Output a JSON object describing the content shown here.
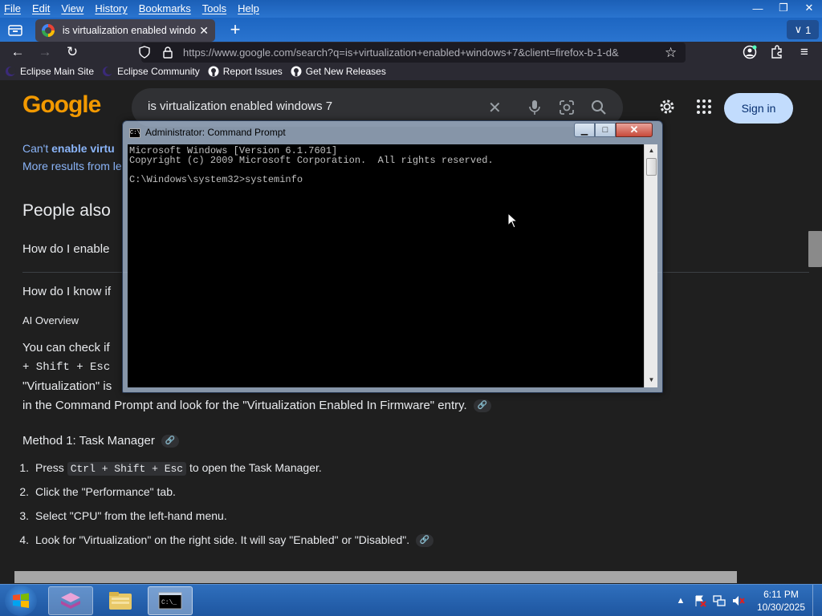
{
  "menu": [
    "File",
    "Edit",
    "View",
    "History",
    "Bookmarks",
    "Tools",
    "Help"
  ],
  "tab": {
    "title": "is virtualization enabled window",
    "count": "1"
  },
  "url": "https://www.google.com/search?q=is+virtualization+enabled+windows+7&client=firefox-b-1-d&",
  "bookmarks": [
    "Eclipse Main Site",
    "Eclipse Community",
    "Report Issues",
    "Get New Releases"
  ],
  "google": {
    "logo": "Google",
    "query": "is virtualization enabled windows 7",
    "signin": "Sign in"
  },
  "results": {
    "cant_enable_prefix": "Can't ",
    "cant_enable_bold": "enable virtu",
    "more_results": "More results from le",
    "people_also": "People also",
    "q1": "How do I enable",
    "q2": "How do I know if",
    "ai_overview": "AI Overview",
    "check_text": "You can check if",
    "shift_esc": "+ Shift + Esc",
    "virtualization_quote": "\"Virtualization\" is",
    "cmd_line": "in the Command Prompt and look for the \"Virtualization Enabled In Firmware\" entry.",
    "method1": "Method 1: Task Manager",
    "steps": [
      {
        "num": "1.",
        "pre": "Press ",
        "kbd": "Ctrl + Shift + Esc",
        "post": " to open the Task Manager."
      },
      {
        "num": "2.",
        "pre": "Click the \"Performance\" tab.",
        "kbd": "",
        "post": ""
      },
      {
        "num": "3.",
        "pre": "Select \"CPU\" from the left-hand menu.",
        "kbd": "",
        "post": ""
      },
      {
        "num": "4.",
        "pre": "Look for \"Virtualization\" on the right side. It will say \"Enabled\" or \"Disabled\".",
        "kbd": "",
        "post": ""
      }
    ]
  },
  "cmd": {
    "title": "Administrator: Command Prompt",
    "line1": "Microsoft Windows [Version 6.1.7601]",
    "line2": "Copyright (c) 2009 Microsoft Corporation.  All rights reserved.",
    "line3": "",
    "line4": "C:\\Windows\\system32>systeminfo"
  },
  "taskbar": {
    "time": "6:11 PM",
    "date": "10/30/2025"
  },
  "colors": {
    "accent": "#8ab4f8",
    "signin_bg": "#c2dcfd",
    "taskbar": "#2f6fbd"
  }
}
